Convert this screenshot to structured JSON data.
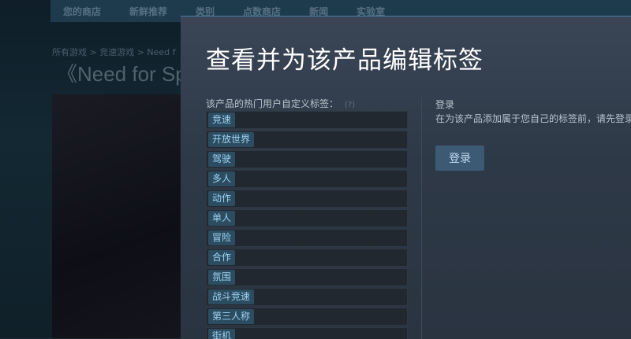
{
  "background": {
    "nav": [
      "您的商店",
      "新鲜推荐",
      "类别",
      "点数商店",
      "新闻",
      "实验室"
    ],
    "breadcrumb": "所有游戏 > 竞速游戏 > Need f",
    "game_title": "《Need for Sp"
  },
  "modal": {
    "title": "查看并为该产品编辑标签",
    "popular_label": "该产品的热门用户自定义标签：",
    "help": "(?)",
    "tags": [
      "竞速",
      "开放世界",
      "驾驶",
      "多人",
      "动作",
      "单人",
      "冒险",
      "合作",
      "氛围",
      "战斗竞速",
      "第三人称",
      "街机"
    ],
    "login": {
      "heading": "登录",
      "description": "在为该产品添加属于您自己的标签前，请先登录。",
      "button": "登录"
    }
  }
}
